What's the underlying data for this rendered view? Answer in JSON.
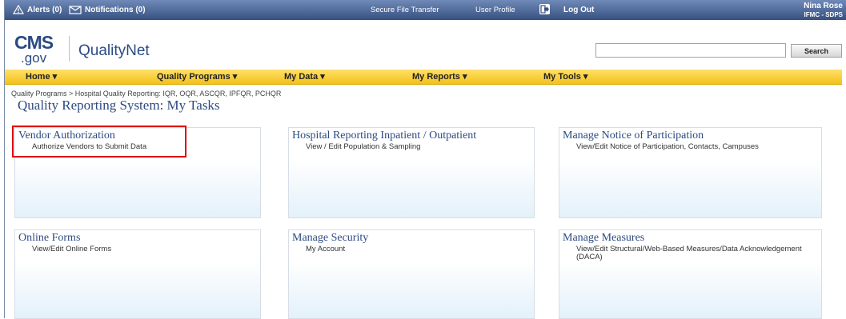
{
  "topbar": {
    "alerts": "Alerts (0)",
    "notifications": "Notifications (0)",
    "secure_file_transfer": "Secure File Transfer",
    "user_profile": "User Profile",
    "log_out": "Log Out",
    "user_name": "Nina Rose",
    "user_org": "IFMC - SDPS"
  },
  "header": {
    "logo_cms": "CMS",
    "logo_gov": ".gov",
    "brand": "QualityNet",
    "search_value": "",
    "search_button": "Search"
  },
  "nav": {
    "items": [
      {
        "label": "Home ▾"
      },
      {
        "label": "Quality Programs ▾"
      },
      {
        "label": "My Data ▾"
      },
      {
        "label": "My Reports ▾"
      },
      {
        "label": "My Tools ▾"
      }
    ]
  },
  "breadcrumb": "Quality Programs > Hospital Quality Reporting: IQR, OQR, ASCQR, IPFQR, PCHQR",
  "page_title": "Quality Reporting System: My Tasks",
  "tiles": [
    {
      "title": "Vendor Authorization",
      "subtitle": "Authorize Vendors to Submit Data"
    },
    {
      "title": "Hospital Reporting Inpatient / Outpatient",
      "subtitle": "View / Edit Population & Sampling"
    },
    {
      "title": "Manage Notice of Participation",
      "subtitle": "View/Edit Notice of Participation, Contacts, Campuses"
    },
    {
      "title": "Online Forms",
      "subtitle": "View/Edit Online Forms"
    },
    {
      "title": "Manage Security",
      "subtitle": "My Account"
    },
    {
      "title": "Manage Measures",
      "subtitle": "View/Edit Structural/Web-Based Measures/Data Acknowledgement (DACA)"
    }
  ],
  "colors": {
    "topbar": "#36507f",
    "nav": "#f3c11e",
    "title_blue": "#2c4a82",
    "highlight": "#e00000"
  }
}
